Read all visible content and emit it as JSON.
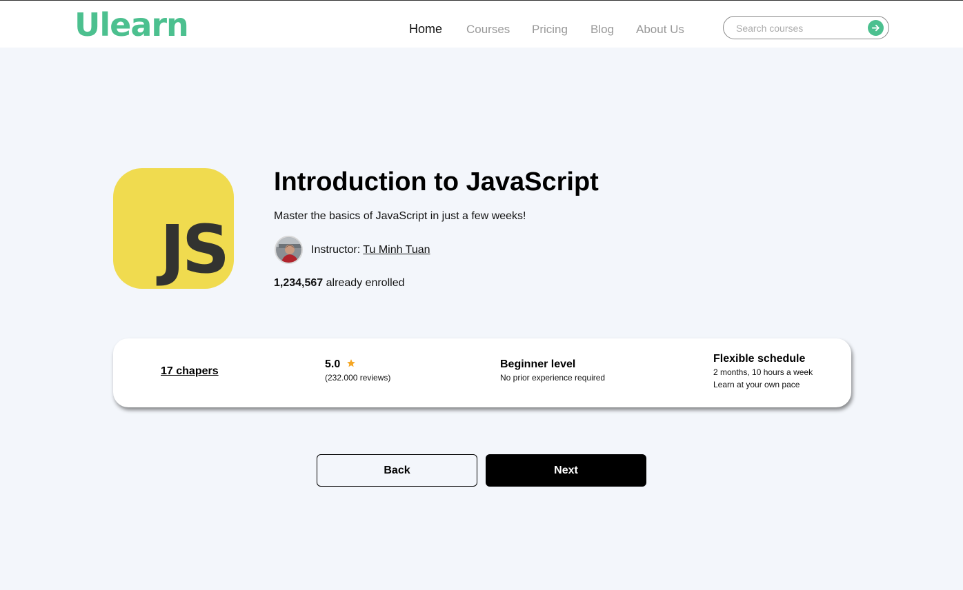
{
  "header": {
    "logo": "Ulearn",
    "nav": [
      {
        "label": "Home",
        "active": true
      },
      {
        "label": "Courses",
        "active": false
      },
      {
        "label": "Pricing",
        "active": false
      },
      {
        "label": "Blog",
        "active": false
      },
      {
        "label": "About Us",
        "active": false
      }
    ],
    "search": {
      "placeholder": "Search courses",
      "value": "",
      "icon": "arrow-right-icon"
    }
  },
  "course": {
    "logo_text": "JS",
    "title": "Introduction to JavaScript",
    "subtitle": "Master the basics of JavaScript in just a few weeks!",
    "instructor_prefix": "Instructor: ",
    "instructor_name": "Tu Minh Tuan",
    "enrolled_count": "1,234,567",
    "enrolled_suffix": " already enrolled"
  },
  "stats": {
    "chapters": "17 chapers",
    "rating_value": "5.0",
    "rating_reviews": "(232.000 reviews)",
    "level_title": "Beginner level",
    "level_desc": "No prior experience required",
    "schedule_title": "Flexible schedule",
    "schedule_line1": "2 months, 10 hours a week",
    "schedule_line2": "Learn at your own pace"
  },
  "actions": {
    "back": "Back",
    "next": "Next"
  },
  "colors": {
    "brand": "#4cc08f",
    "js_yellow": "#f0db4f",
    "star": "#f5a623",
    "page_bg": "#f3f6fb"
  }
}
